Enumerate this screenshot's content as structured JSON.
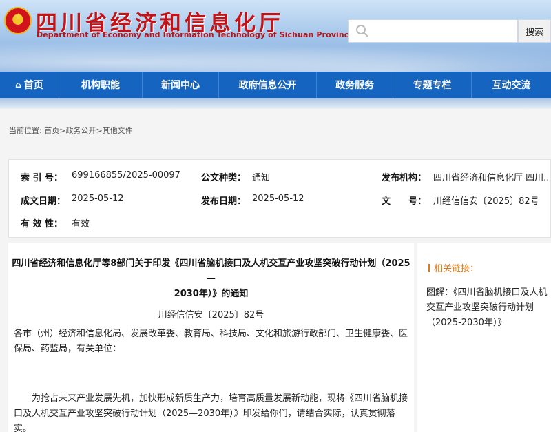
{
  "header": {
    "title": "四川省经济和信息化厅",
    "subtitle": "Department of Economy and Information Technology of Sichuan Province",
    "search_placeholder": "",
    "search_button": "搜索",
    "colors": {
      "title_red": "#c21318",
      "nav_blue": "#1565c0",
      "accent_orange": "#e07a16"
    }
  },
  "nav": {
    "items": [
      {
        "label": "首页",
        "icon": "home-icon"
      },
      {
        "label": "机构职能"
      },
      {
        "label": "新闻中心"
      },
      {
        "label": "政府信息公开"
      },
      {
        "label": "政务服务"
      },
      {
        "label": "专题专栏"
      },
      {
        "label": "互动交流"
      }
    ]
  },
  "breadcrumb": {
    "prefix": "当前位置:",
    "items": [
      "首页",
      "政务公开",
      "其他文件"
    ],
    "separator": ">"
  },
  "meta": {
    "index_label": "索 引 号：",
    "index_value": "699166855/2025-00097",
    "type_label": "公文种类：",
    "type_value": "通知",
    "publisher_label": "发布机构：",
    "publisher_value": "四川省经济和信息化厅 四川...",
    "created_label": "成文日期：",
    "created_value": "2025-05-12",
    "published_label": "发布日期：",
    "published_value": "2025-05-12",
    "docno_label": "文　　号：",
    "docno_value": "川经信信安〔2025〕82号",
    "validity_label": "有 效 性：",
    "validity_value": "有效"
  },
  "article": {
    "title_line1": "四川省经济和信息化厅等8部门关于印发《四川省脑机接口及人机交互产业攻坚突破行动计划（2025—",
    "title_line2": "2030年）》的通知",
    "doc_number": "川经信信安〔2025〕82号",
    "recipients": "各市（州）经济和信息化局、发展改革委、教育局、科技局、文化和旅游行政部门、卫生健康委、医保局、药监局，有关单位：",
    "body": "为抢占未来产业发展先机，加快形成新质生产力，培育高质量发展新动能，现将《四川省脑机接口及人机交互产业攻坚突破行动计划（2025—2030年）》印发给你们，请结合实际，认真贯彻落实。"
  },
  "sidebar": {
    "heading": "相关链接：",
    "link": "图解：《四川省脑机接口及人机交互产业攻坚突破行动计划（2025-2030年）》"
  }
}
